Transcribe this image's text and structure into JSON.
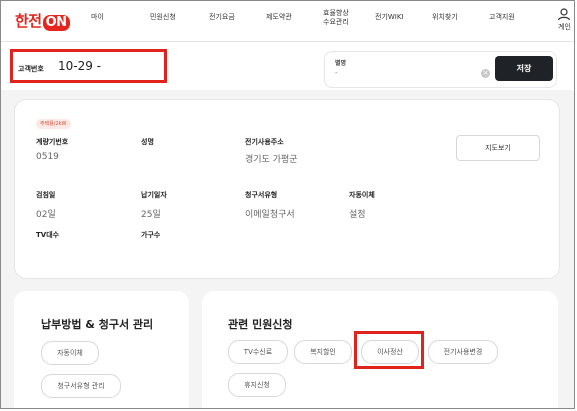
{
  "nav": {
    "logo_text": "한전",
    "logo_badge": "ON",
    "items": [
      "마이",
      "민원신청",
      "전기요금",
      "제도약관",
      "효율향상\n수요관리",
      "전기WIKI",
      "위치찾기",
      "고객지원"
    ],
    "user_label": "계인"
  },
  "customer": {
    "label": "고객번호",
    "value": "10-29    -"
  },
  "search": {
    "label": "별명",
    "placeholder": "-",
    "clear": "×",
    "save_label": "저장"
  },
  "info": {
    "tag": "주택용/2kW",
    "fields": [
      {
        "label": "계량기번호",
        "value": "0519"
      },
      {
        "label": "성명",
        "value": ""
      },
      {
        "label": "전기사용주소",
        "value": "경기도 가평군"
      },
      {
        "label": "검침일",
        "value": "02일"
      },
      {
        "label": "납기일자",
        "value": "25일"
      },
      {
        "label": "청구서유형",
        "value": "이메일청구서"
      },
      {
        "label": "자동이체",
        "value": "설정"
      },
      {
        "label": "TV대수",
        "value": ""
      },
      {
        "label": "가구수",
        "value": ""
      }
    ],
    "map_button": "지도보기"
  },
  "payment_card": {
    "title": "납부방법 & 청구서 관리",
    "chips": [
      "자동이체",
      "청구서유형 관리"
    ]
  },
  "civil_card": {
    "title": "관련 민원신청",
    "chips": [
      "TV수신료",
      "복지할인",
      "이사정산",
      "전기사용변경",
      "휴지신청"
    ]
  },
  "colors": {
    "brand": "#e4261f",
    "highlight": "#e0241d",
    "save_button": "#1f2226"
  }
}
